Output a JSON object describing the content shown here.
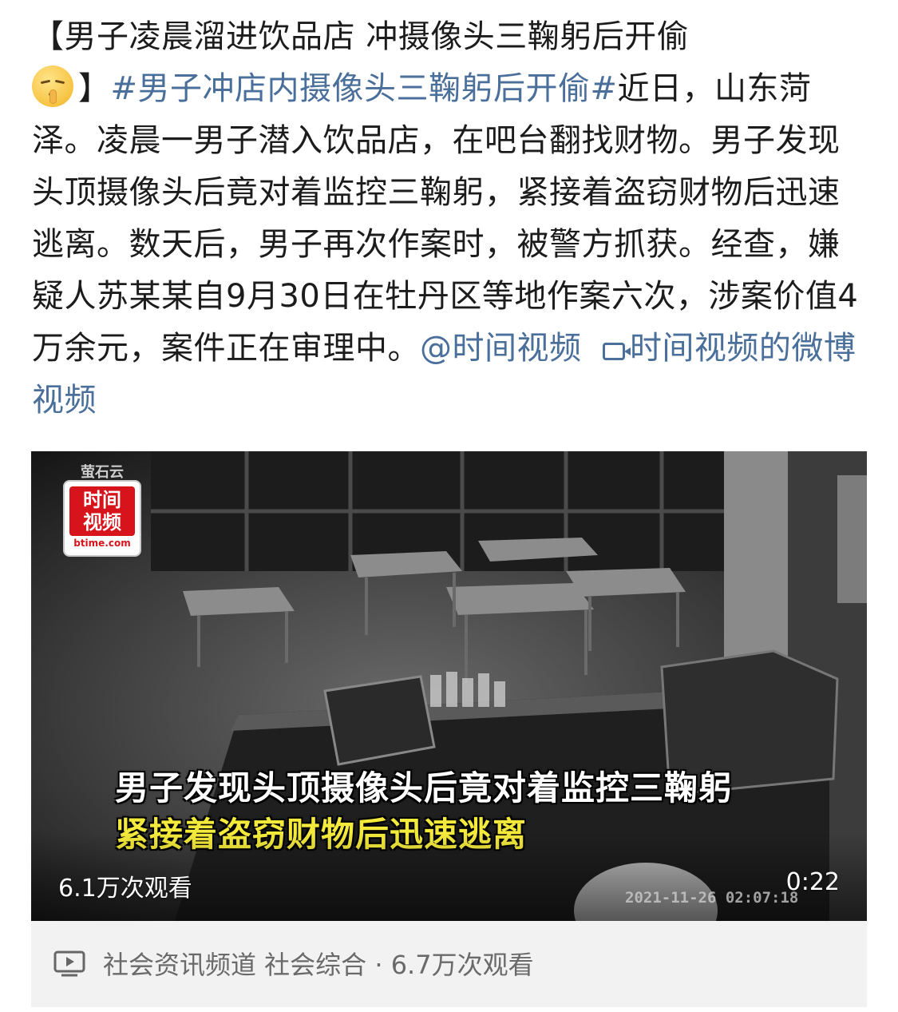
{
  "post": {
    "title": "【男子凌晨溜进饮品店 冲摄像头三鞠躬后开偷",
    "emoji_icon": "shushing-face-icon",
    "bracket_close": "】",
    "topic": "#男子冲店内摄像头三鞠躬后开偷#",
    "body": "近日，山东菏泽。凌晨一男子潜入饮品店，在吧台翻找财物。男子发现头顶摄像头后竟对着监控三鞠躬，紧接着盗窃财物后迅速逃离。数天后，男子再次作案时，被警方抓获。经查，嫌疑人苏某某自9月30日在牡丹区等地作案六次，涉案价值4万余元，案件正在审理中。",
    "mention": "@时间视频",
    "video_link": "时间视频的微博视频",
    "link_color": "#4a6f9b"
  },
  "video": {
    "watermark_brand": "萤石云",
    "logo_line1": "时间",
    "logo_line2": "视频",
    "logo_domain": "btime.com",
    "caption_line1": "男子发现头顶摄像头后竟对着监控三鞠躬",
    "caption_line2": "紧接着盗窃财物后迅速逃离",
    "caption_line2_color": "#f4ea3c",
    "view_count": "6.1万次观看",
    "duration": "0:22",
    "cctv_timestamp": "2021-11-26 02:07:18"
  },
  "meta": {
    "icon": "video-play-icon",
    "text": "社会资讯频道 社会综合 · 6.7万次观看"
  }
}
